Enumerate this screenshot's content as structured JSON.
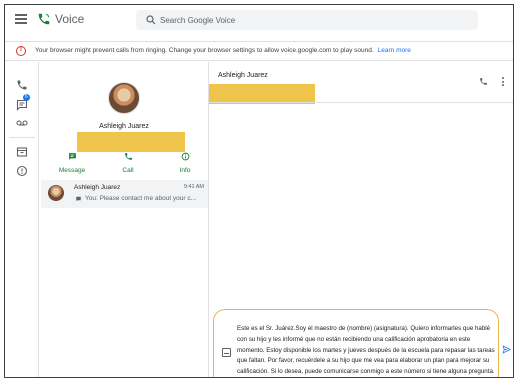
{
  "app": {
    "title": "Voice"
  },
  "search": {
    "placeholder": "Search Google Voice"
  },
  "banner": {
    "text": "Your browser might prevent calls from ringing. Change your browser settings to allow voice.google.com to play sound.",
    "link": "Learn more"
  },
  "nav": {
    "badge_count": "6"
  },
  "contact": {
    "name": "Ashleigh Juarez",
    "actions": [
      {
        "label": "Message"
      },
      {
        "label": "Call"
      },
      {
        "label": "Info"
      }
    ]
  },
  "thread": {
    "name": "Ashleigh Juarez",
    "time": "9:41 AM",
    "preview": "You: Please contact me about your c..."
  },
  "conversation": {
    "title": "Ashleigh Juarez",
    "draft": "Este es el Sr. Juárez.Soy el maestro de (nombre) (asignatura). Quiero informarles que hablé con su hijo y les informé que no están recibiendo una calificación aprobatoria en este momento. Estoy disponible los martes y jueves después de la escuela para repasar las tareas que faltan. Por favor, recuérdele a su hijo que me vea para elaborar un plan para mejorar su calificación. Si lo desea, puede comunicarse conmigo a este número si tiene alguna pregunta."
  },
  "colors": {
    "accent": "#1a73e8",
    "green": "#188038",
    "warning": "#d93025",
    "highlight": "#efc44b",
    "compose_border": "#e8b64a"
  }
}
